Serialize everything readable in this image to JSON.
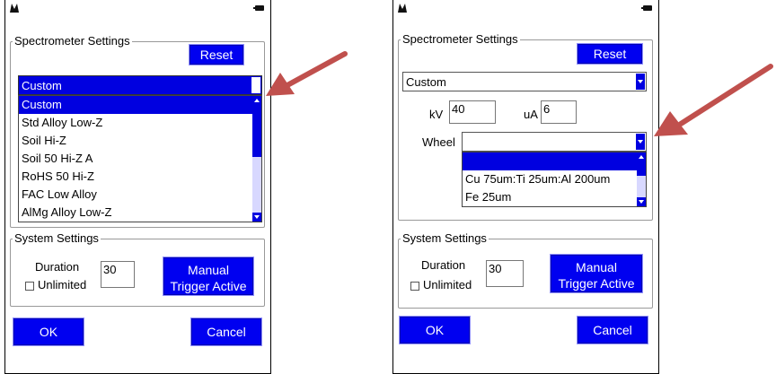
{
  "colors": {
    "button_blue": "#0000f0",
    "arrow_red": "#c0504d",
    "list_selected": "#0000e0"
  },
  "left": {
    "spectrometer_title": "Spectrometer Settings",
    "reset_label": "Reset",
    "dropdown_value": "Custom",
    "list_items": [
      "Custom",
      "Std Alloy Low-Z",
      "Soil Hi-Z",
      "Soil 50 Hi-Z A",
      "RoHS 50 Hi-Z",
      "FAC Low Alloy",
      "AlMg Alloy Low-Z"
    ],
    "system_title": "System Settings",
    "duration_label": "Duration",
    "duration_value": "30",
    "unlimited_label": "Unlimited",
    "manual_line1": "Manual",
    "manual_line2": "Trigger Active",
    "ok_label": "OK",
    "cancel_label": "Cancel"
  },
  "right": {
    "spectrometer_title": "Spectrometer Settings",
    "reset_label": "Reset",
    "dropdown_value": "Custom",
    "kv_label": "kV",
    "kv_value": "40",
    "ua_label": "uA",
    "ua_value": "6",
    "wheel_label": "Wheel",
    "wheel_value": "",
    "wheel_items": [
      "",
      "Cu 75um:Ti 25um:Al 200um",
      "Fe 25um"
    ],
    "system_title": "System Settings",
    "duration_label": "Duration",
    "duration_value": "30",
    "unlimited_label": "Unlimited",
    "manual_line1": "Manual",
    "manual_line2": "Trigger Active",
    "ok_label": "OK",
    "cancel_label": "Cancel"
  }
}
